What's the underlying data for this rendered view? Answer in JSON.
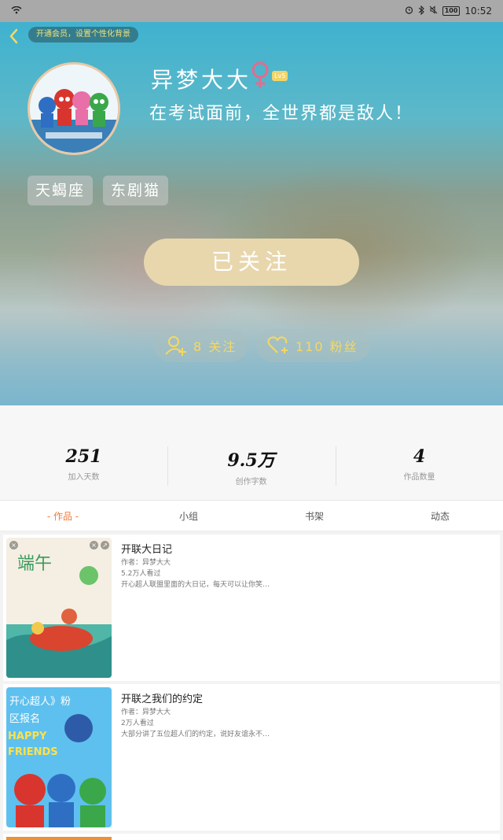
{
  "status_bar": {
    "time": "10:52",
    "battery": "100"
  },
  "profile": {
    "vip_notice": "开通会员，设置个性化背景",
    "username": "异梦大大",
    "level_badge": "Lv5",
    "signature": "在考试面前，全世界都是敌人！",
    "tags": [
      "天蝎座",
      "东剧猫"
    ],
    "follow_button": "已关注",
    "following_label": "8 关注",
    "fans_label": "110 粉丝"
  },
  "stats": [
    {
      "value": "251",
      "label": "加入天数"
    },
    {
      "value": "9.5万",
      "label": "创作字数"
    },
    {
      "value": "4",
      "label": "作品数量"
    }
  ],
  "tabs": [
    {
      "label": "- 作品 -",
      "active": true
    },
    {
      "label": "小组",
      "active": false
    },
    {
      "label": "书架",
      "active": false
    },
    {
      "label": "动态",
      "active": false
    }
  ],
  "works": [
    {
      "title": "开联大日记",
      "author": "作者：异梦大大",
      "views": "5.2万人看过",
      "summary": "开心超人联盟里面的大日记，每天可以让你笑…",
      "cover_text": "端午"
    },
    {
      "title": "开联之我们的约定",
      "author": "作者：异梦大大",
      "views": "2万人看过",
      "summary": "大部分讲了五位超人们的约定，说好友谊永不…",
      "cover_text": "开心超人》粉区报名 HAPPY FRIENDS"
    }
  ],
  "colors": {
    "accent_tab": "#f07a3c",
    "follow_button": "#e8d7ad",
    "stat_pill_text": "#f5d861",
    "avatar_border": "#e9c9a6"
  }
}
